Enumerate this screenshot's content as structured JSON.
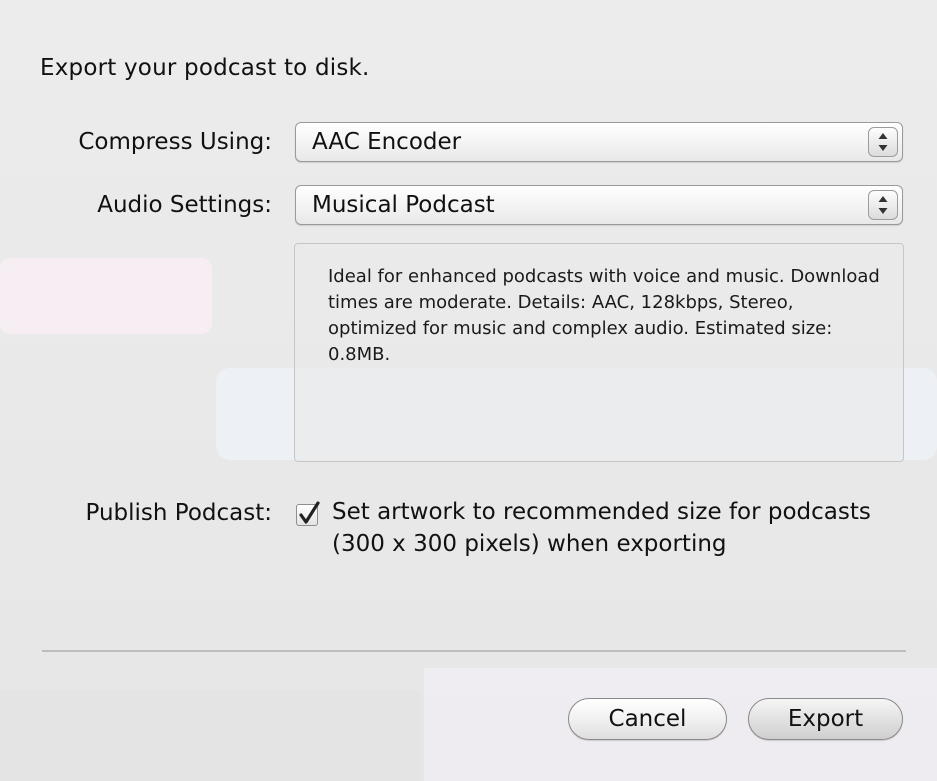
{
  "dialog": {
    "intro": "Export your podcast to disk.",
    "compress": {
      "label": "Compress Using:",
      "value": "AAC Encoder"
    },
    "audio": {
      "label": "Audio Settings:",
      "value": "Musical Podcast",
      "description": "Ideal for enhanced podcasts with voice and music. Download times are moderate. Details: AAC, 128kbps, Stereo, optimized for music and complex audio. Estimated size: 0.8MB."
    },
    "publish": {
      "label": "Publish Podcast:",
      "checked": true,
      "text": "Set artwork to recommended size for podcasts (300 x 300 pixels) when exporting"
    },
    "buttons": {
      "cancel": "Cancel",
      "export": "Export"
    }
  },
  "icons": {
    "popup_stepper": "up-down-arrows-icon",
    "checkbox": "checkmark-icon"
  }
}
